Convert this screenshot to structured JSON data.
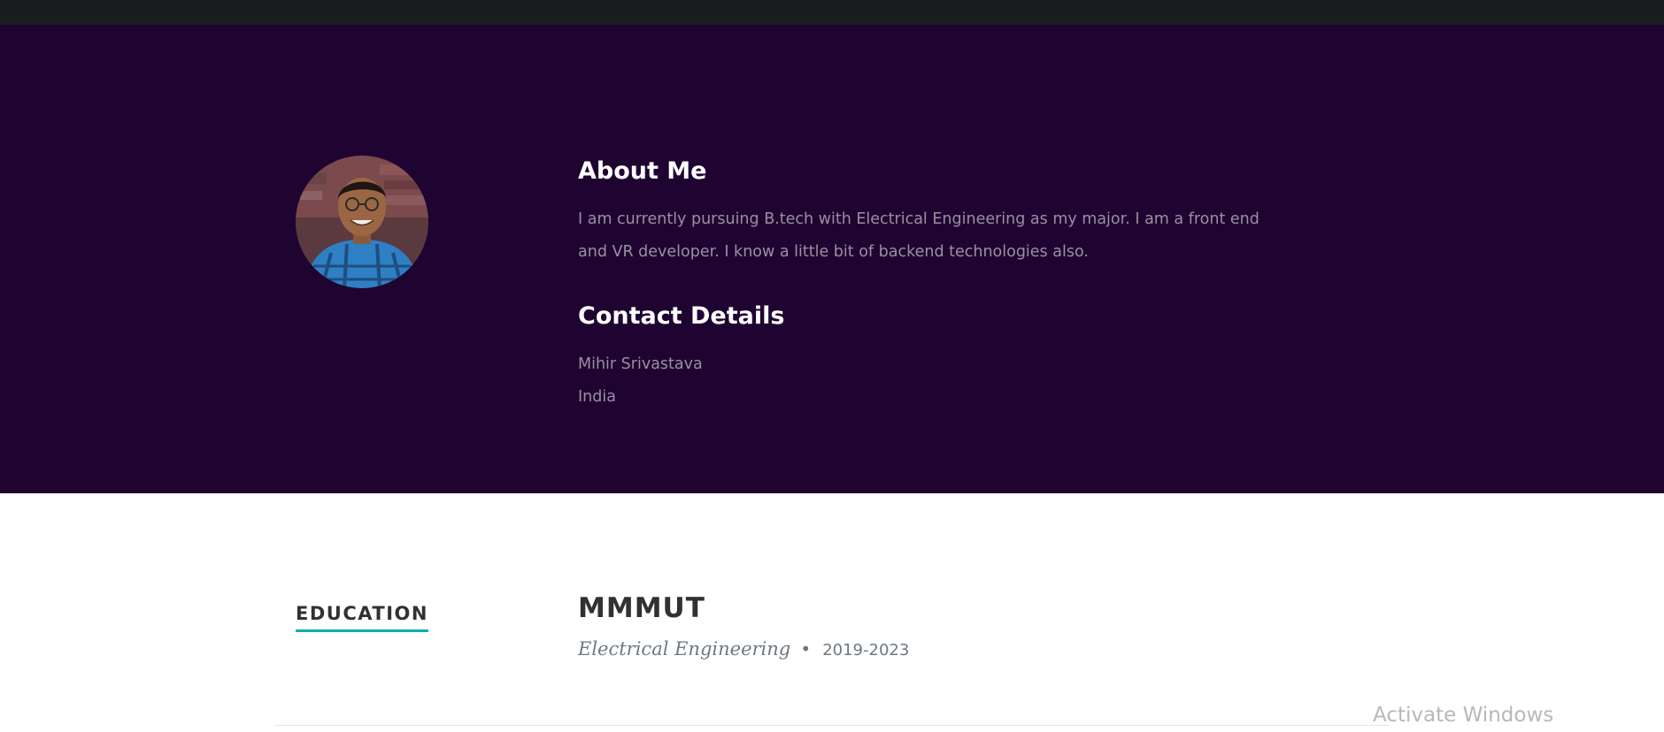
{
  "about": {
    "title": "About Me",
    "text": "I am currently pursuing B.tech with Electrical Engineering as my major. I am a front end and VR developer. I know a little bit of backend technologies also."
  },
  "contact": {
    "title": "Contact Details",
    "name": "Mihir Srivastava",
    "location": "India"
  },
  "education": {
    "label": "EDUCATION",
    "school": "MMMUT",
    "degree": "Electrical Engineering",
    "bullet": "•",
    "years": "2019-2023"
  },
  "system": {
    "watermark": "Activate Windows"
  },
  "colors": {
    "about_background": "#1f0432",
    "top_bar": "#1b1c20",
    "accent_underline": "#11abb0",
    "muted_text": "#9a8fa3"
  },
  "icons": {
    "avatar": "profile-photo"
  }
}
